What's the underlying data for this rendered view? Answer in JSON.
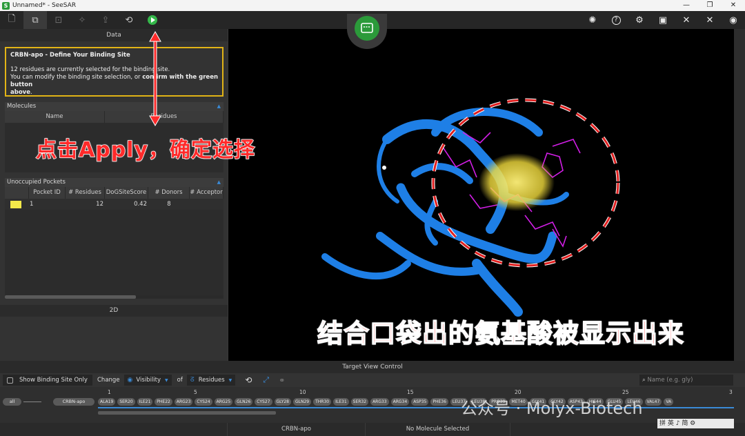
{
  "window": {
    "title": "Unnamed* - SeeSAR",
    "app_icon": "S",
    "min": "—",
    "max": "❐",
    "close": "✕"
  },
  "toolbar": {
    "left": [
      {
        "name": "document-icon",
        "glyph": "🗋"
      },
      {
        "name": "binding-site-icon",
        "glyph": "⧉"
      },
      {
        "name": "inspector-icon",
        "glyph": "⊡"
      },
      {
        "name": "pin-icon",
        "glyph": "✧"
      },
      {
        "name": "export-icon",
        "glyph": "⇪"
      },
      {
        "name": "reset-icon",
        "glyph": "⟲"
      }
    ],
    "right": [
      {
        "name": "bulb-icon",
        "glyph": "✺"
      },
      {
        "name": "help-icon",
        "glyph": "?"
      },
      {
        "name": "settings-icon",
        "glyph": "⚙"
      },
      {
        "name": "monitor-icon",
        "glyph": "▣"
      },
      {
        "name": "tools-icon",
        "glyph": "✕"
      },
      {
        "name": "wrench-icon",
        "glyph": "✕"
      },
      {
        "name": "eye-icon",
        "glyph": "◉"
      }
    ]
  },
  "left_panel": {
    "header": "Data",
    "info_title": "CRBN-apo - Define Your Binding Site",
    "info_line1": "12 residues are currently selected for the binding site.",
    "info_line2a": "You can modify the binding site selection, or ",
    "info_line2b": "confirm with the green button",
    "info_line3": "above",
    "info_line3_end": ".",
    "molecules": {
      "title": "Molecules",
      "col_name": "Name",
      "col_residues": "Residues"
    },
    "pockets": {
      "title": "Unoccupied Pockets",
      "columns": [
        "Pocket ID",
        "# Residues",
        "DoGSiteScore",
        "# Donors",
        "# Acceptor"
      ],
      "rows": [
        {
          "id": "1",
          "residues": "12",
          "score": "0.42",
          "donors": "8",
          "acceptors": ""
        }
      ]
    },
    "panel_2d": "2D"
  },
  "target_view": {
    "title": "Target View Control",
    "show_binding": "Show Binding Site Only",
    "change": "Change",
    "visibility": "Visibility",
    "of": "of",
    "residues": "Residues",
    "search_placeholder": "Name (e.g. gly)",
    "all": "all",
    "chain": "CRBN-apo",
    "numbers": [
      "1",
      "5",
      "10",
      "15",
      "20",
      "25",
      "3"
    ],
    "residue_list": [
      "ALA19",
      "SER20",
      "ILE21",
      "PHE22",
      "ARG23",
      "CYS24",
      "ARG25",
      "GLN26",
      "CYS27",
      "GLY28",
      "GLN29",
      "THR30",
      "ILE31",
      "SER32",
      "ARG33",
      "ARG34",
      "ASP35",
      "PHE36",
      "LEU37",
      "LEU38",
      "PRO39",
      "MET40",
      "GLY41",
      "GLY42",
      "ASP43",
      "HIS44",
      "GLU45",
      "LEU46",
      "VAL47",
      "VA"
    ]
  },
  "status": {
    "left": "",
    "mid1": "CRBN-apo",
    "mid2": "No Molecule Selected",
    "right": ""
  },
  "annotations": {
    "apply": "点击Apply，确定选择",
    "pocket": "结合口袋出的氨基酸被显示出来",
    "watermark": "公众号 · Molyx-Biotech"
  },
  "ime": "  拼 英 ♪ 简 ⚙",
  "colors": {
    "accent_blue": "#3a8bd8",
    "highlight_yellow": "#e2b416",
    "confirm_green": "#34b84a",
    "protein_blue": "#1e7fe6",
    "ligand_magenta": "#d21ee6"
  }
}
